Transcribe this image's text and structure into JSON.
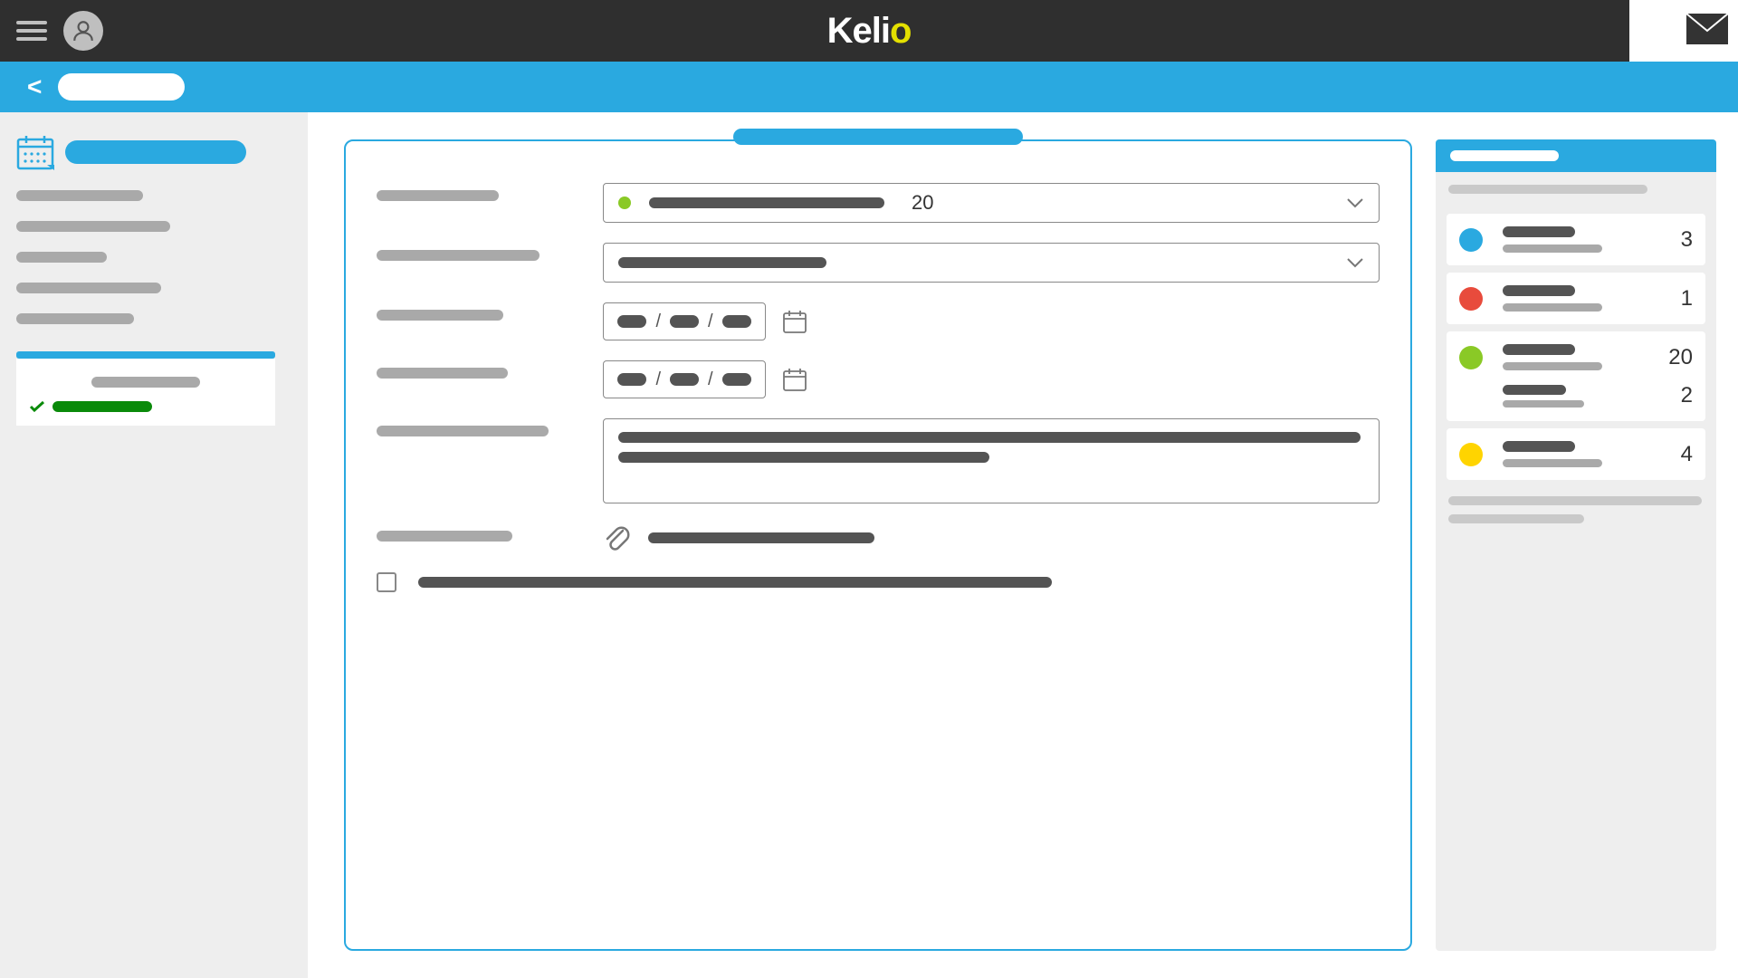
{
  "header": {
    "logo_main": "Keli",
    "logo_o": "o"
  },
  "bluebar": {
    "back": "<"
  },
  "sidebar": {
    "items_w": [
      140,
      170,
      100,
      160,
      130
    ],
    "submenu": {
      "grey_w": 120,
      "green_w": 110
    }
  },
  "form": {
    "labels_w": [
      135,
      180,
      140,
      145,
      190,
      150
    ],
    "select1": {
      "dot_color": "#8ac926",
      "txt_w": 260,
      "count": "20"
    },
    "select2": {
      "txt_w": 230
    },
    "textarea_lines_w": [
      820,
      410
    ],
    "attach_txt_w": 250,
    "checkbox_label_w": 700
  },
  "summary": {
    "cards": [
      {
        "color": "#2aa9e0",
        "count": "3"
      },
      {
        "color": "#e84b3c",
        "count": "1"
      },
      {
        "color": "#8ac926",
        "count": "20",
        "sub_count": "2"
      },
      {
        "color": "#ffd400",
        "count": "4"
      }
    ]
  }
}
